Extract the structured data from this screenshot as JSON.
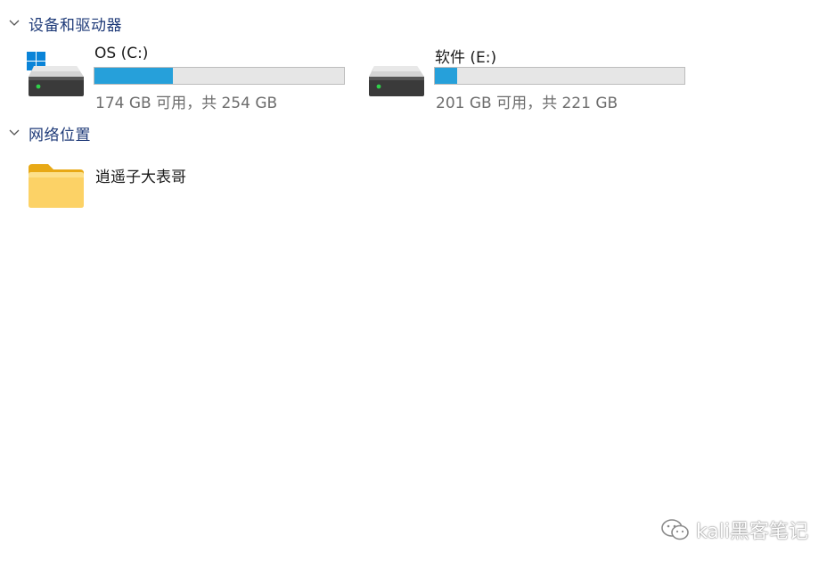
{
  "sections": {
    "devices": {
      "title": "设备和驱动器"
    },
    "network": {
      "title": "网络位置"
    }
  },
  "drives": [
    {
      "name": "OS (C:)",
      "free_text": "174 GB 可用，共 254 GB",
      "used_fraction": 0.315
    },
    {
      "name": "软件 (E:)",
      "free_text": "201 GB 可用，共 221 GB",
      "used_fraction": 0.09
    }
  ],
  "network_locations": [
    {
      "name": "逍遥子大表哥"
    }
  ],
  "watermark": {
    "text": "kali黑客笔记"
  },
  "colors": {
    "section_title": "#1e3a78",
    "bar_fill": "#26a0da",
    "bar_bg": "#e6e6e6",
    "free_text": "#6d6d6d"
  },
  "icons": {
    "section_toggle": "chevron-down-icon",
    "system_drive": "windows-drive-icon",
    "drive": "hard-drive-icon",
    "network_location": "folder-icon",
    "watermark": "wechat-icon"
  }
}
